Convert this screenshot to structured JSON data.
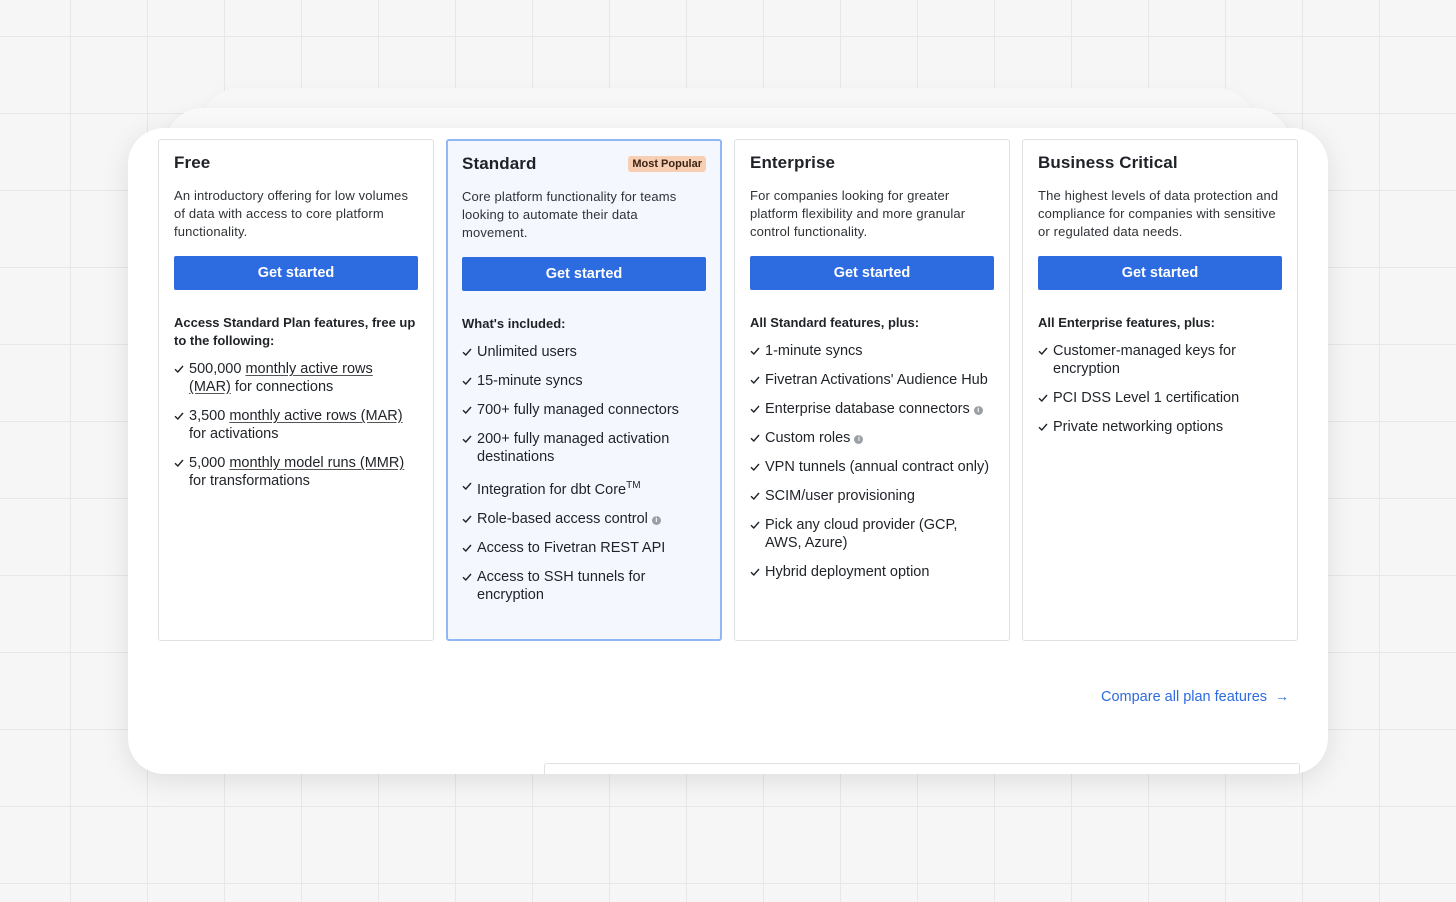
{
  "plans": [
    {
      "name": "Free",
      "badge": "",
      "description": "An introductory offering for low volumes of data with access to core platform functionality.",
      "cta": "Get started",
      "features_heading": "Access Standard Plan features, free up to the following:",
      "features": [
        {
          "pre": "500,000 ",
          "link": "monthly active rows (MAR)",
          "post": " for connections",
          "info": false
        },
        {
          "pre": "3,500 ",
          "link": "monthly active rows (MAR)",
          "post": " for activations",
          "info": false
        },
        {
          "pre": "5,000 ",
          "link": "monthly model runs (MMR)",
          "post": " for transformations",
          "info": false
        }
      ]
    },
    {
      "name": "Standard",
      "badge": "Most Popular",
      "description": "Core platform functionality for teams looking to automate their data movement.",
      "cta": "Get started",
      "features_heading": "What's included:",
      "features": [
        {
          "pre": "Unlimited users",
          "info": false
        },
        {
          "pre": "15-minute syncs",
          "info": false
        },
        {
          "pre": "700+ fully managed connectors",
          "info": false
        },
        {
          "pre": "200+ fully managed activation destinations",
          "info": false
        },
        {
          "pre": "Integration for dbt Core",
          "sup": "TM",
          "info": false
        },
        {
          "pre": "Role-based access control",
          "info": true
        },
        {
          "pre": "Access to Fivetran REST API",
          "info": false
        },
        {
          "pre": "Access to SSH tunnels for encryption",
          "info": false
        }
      ]
    },
    {
      "name": "Enterprise",
      "badge": "",
      "description": "For companies looking for greater platform flexibility and more granular control functionality.",
      "cta": "Get started",
      "features_heading": "All Standard features, plus:",
      "features": [
        {
          "pre": "1-minute syncs",
          "info": false
        },
        {
          "pre": "Fivetran Activations' Audience Hub",
          "info": false
        },
        {
          "pre": "Enterprise database connectors",
          "info": true
        },
        {
          "pre": "Custom roles",
          "info": true
        },
        {
          "pre": "VPN tunnels (annual contract only)",
          "info": false
        },
        {
          "pre": "SCIM/user provisioning",
          "info": false
        },
        {
          "pre": "Pick any cloud provider (GCP, AWS, Azure)",
          "info": false
        },
        {
          "pre": "Hybrid deployment option",
          "info": false
        }
      ]
    },
    {
      "name": "Business Critical",
      "badge": "",
      "description": "The highest levels of data protection and compliance for companies with sensitive or regulated data needs.",
      "cta": "Get started",
      "features_heading": "All Enterprise features, plus:",
      "features": [
        {
          "pre": "Customer-managed keys for encryption",
          "info": false
        },
        {
          "pre": "PCI DSS Level 1 certification",
          "info": false
        },
        {
          "pre": "Private networking options",
          "info": false
        }
      ]
    }
  ],
  "compare_link": "Compare all plan features",
  "colors": {
    "accent": "#2d6be0",
    "badge_bg": "#f8cfb3",
    "popular_border": "#8fb7f2"
  }
}
